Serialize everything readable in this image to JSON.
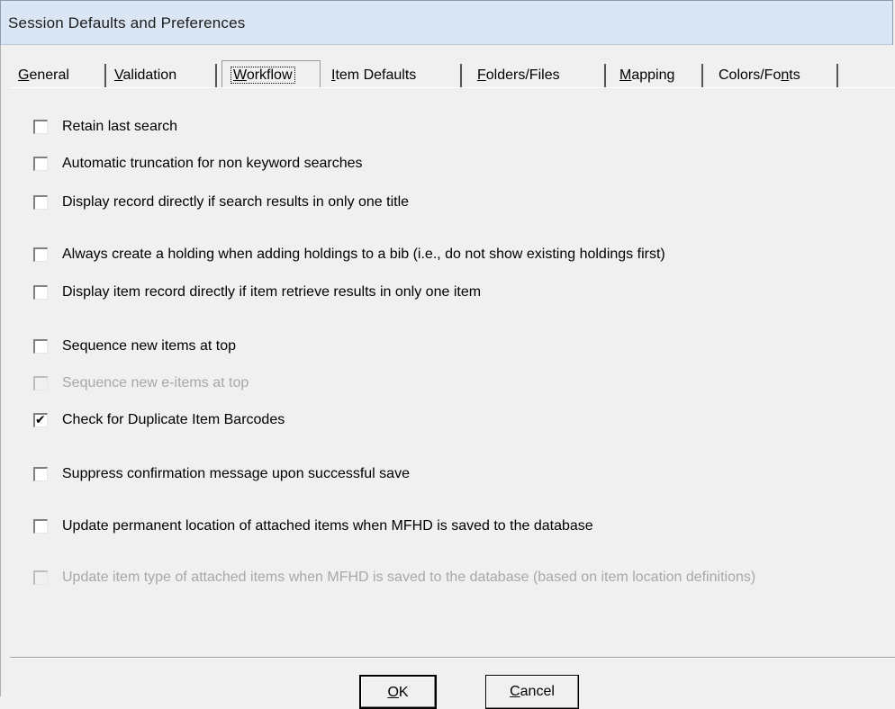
{
  "window": {
    "title": "Session Defaults and Preferences"
  },
  "tabs": [
    {
      "prefix": "",
      "accel": "G",
      "rest": "eneral",
      "active": false
    },
    {
      "prefix": "",
      "accel": "V",
      "rest": "alidation",
      "active": false
    },
    {
      "prefix": "",
      "accel": "W",
      "rest": "orkflow",
      "active": true
    },
    {
      "prefix": "",
      "accel": "I",
      "rest": "tem Defaults",
      "active": false
    },
    {
      "prefix": "",
      "accel": "F",
      "rest": "olders/Files",
      "active": false
    },
    {
      "prefix": "",
      "accel": "M",
      "rest": "apping",
      "active": false
    },
    {
      "prefix": "Colors/Fo",
      "accel": "n",
      "rest": "ts",
      "active": false
    }
  ],
  "options": [
    {
      "label": "Retain last search",
      "checked": false,
      "enabled": true
    },
    {
      "label": "Automatic truncation for non keyword searches",
      "checked": false,
      "enabled": true
    },
    {
      "label": "Display record directly if search results in only one title",
      "checked": false,
      "enabled": true
    },
    {
      "label": "Always create a holding when adding holdings to a bib (i.e., do not show existing holdings first)",
      "checked": false,
      "enabled": true
    },
    {
      "label": "Display item record directly if item retrieve results in only one item",
      "checked": false,
      "enabled": true
    },
    {
      "label": "Sequence new items at top",
      "checked": false,
      "enabled": true
    },
    {
      "label": "Sequence new e-items at top",
      "checked": false,
      "enabled": false
    },
    {
      "label": "Check for Duplicate Item Barcodes",
      "checked": true,
      "enabled": true
    },
    {
      "label": "Suppress confirmation message upon successful save",
      "checked": false,
      "enabled": true
    },
    {
      "label": "Update permanent location of attached items when MFHD is saved to the database",
      "checked": false,
      "enabled": true
    },
    {
      "label": "Update item type of attached items when MFHD is saved to the database (based on item location definitions)",
      "checked": false,
      "enabled": false
    }
  ],
  "buttons": {
    "ok": {
      "accel": "O",
      "rest": "K"
    },
    "cancel": {
      "accel": "C",
      "rest": "ancel"
    }
  }
}
